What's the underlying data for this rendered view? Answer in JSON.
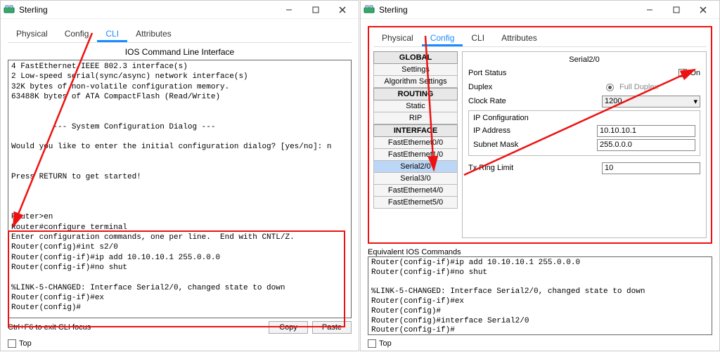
{
  "left": {
    "title": "Sterling",
    "tabs": [
      "Physical",
      "Config",
      "CLI",
      "Attributes"
    ],
    "active_tab": "CLI",
    "cli_heading": "IOS Command Line Interface",
    "cli_text": "4 FastEthernet/IEEE 802.3 interface(s)\n2 Low-speed serial(sync/async) network interface(s)\n32K bytes of non-volatile configuration memory.\n63488K bytes of ATA CompactFlash (Read/Write)\n\n\n         --- System Configuration Dialog ---\n\nWould you like to enter the initial configuration dialog? [yes/no]: n\n\n\nPress RETURN to get started!\n\n\n\nRouter>en\nRouter#configure terminal\nEnter configuration commands, one per line.  End with CNTL/Z.\nRouter(config)#int s2/0\nRouter(config-if)#ip add 10.10.10.1 255.0.0.0\nRouter(config-if)#no shut\n\n%LINK-5-CHANGED: Interface Serial2/0, changed state to down\nRouter(config-if)#ex\nRouter(config)#",
    "hint": "Ctrl+F6 to exit CLI focus",
    "copy": "Copy",
    "paste": "Paste",
    "top": "Top"
  },
  "right": {
    "title": "Sterling",
    "tabs": [
      "Physical",
      "Config",
      "CLI",
      "Attributes"
    ],
    "active_tab": "Config",
    "sidebar": {
      "global": "GLOBAL",
      "global_items": [
        "Settings",
        "Algorithm Settings"
      ],
      "routing": "ROUTING",
      "routing_items": [
        "Static",
        "RIP"
      ],
      "interface": "INTERFACE",
      "interface_items": [
        "FastEthernet0/0",
        "FastEthernet1/0",
        "Serial2/0",
        "Serial3/0",
        "FastEthernet4/0",
        "FastEthernet5/0"
      ],
      "selected": "Serial2/0"
    },
    "panel": {
      "title": "Serial2/0",
      "port_status": "Port Status",
      "on": "On",
      "on_checked": true,
      "duplex": "Duplex",
      "full_duplex": "Full Duplex",
      "clock_rate": "Clock Rate",
      "clock_rate_val": "1200",
      "ipcfg": "IP Configuration",
      "ip_address": "IP Address",
      "ip_address_val": "10.10.10.1",
      "subnet": "Subnet Mask",
      "subnet_val": "255.0.0.0",
      "txring": "Tx Ring Limit",
      "txring_val": "10"
    },
    "eq_label": "Equivalent IOS Commands",
    "eq_text": "Router(config-if)#ip add 10.10.10.1 255.0.0.0\nRouter(config-if)#no shut\n\n%LINK-5-CHANGED: Interface Serial2/0, changed state to down\nRouter(config-if)#ex\nRouter(config)#\nRouter(config)#interface Serial2/0\nRouter(config-if)#",
    "top": "Top"
  }
}
